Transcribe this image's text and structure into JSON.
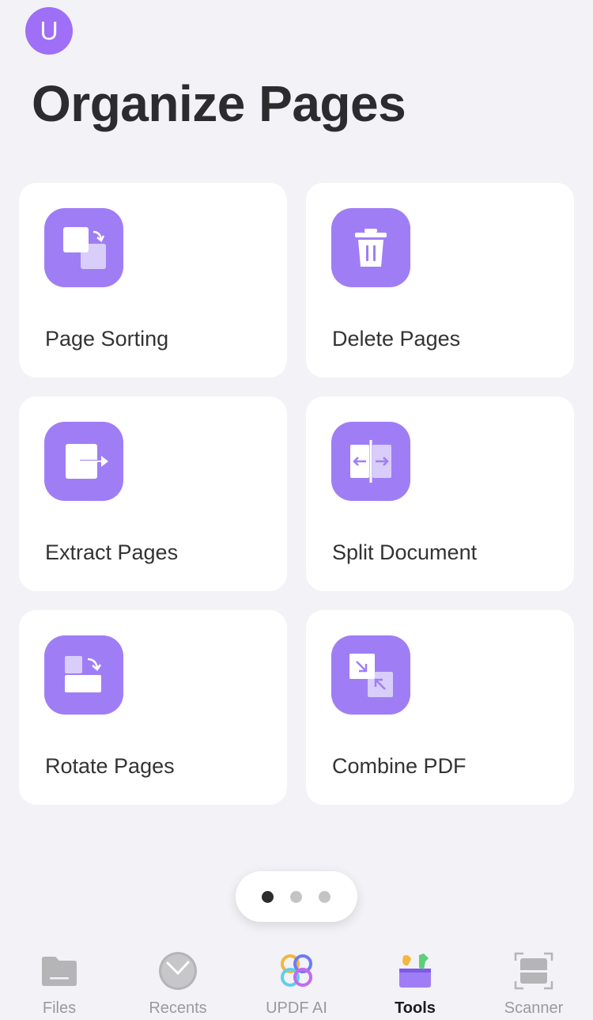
{
  "header": {
    "avatar_letter": "U",
    "title": "Organize Pages"
  },
  "tools": [
    {
      "label": "Page Sorting",
      "icon": "page-sorting-icon"
    },
    {
      "label": "Delete Pages",
      "icon": "trash-icon"
    },
    {
      "label": "Extract Pages",
      "icon": "extract-pages-icon"
    },
    {
      "label": "Split Document",
      "icon": "split-document-icon"
    },
    {
      "label": "Rotate Pages",
      "icon": "rotate-pages-icon"
    },
    {
      "label": "Combine PDF",
      "icon": "combine-pdf-icon"
    }
  ],
  "pager": {
    "pages": 3,
    "active": 1
  },
  "tabbar": {
    "items": [
      {
        "label": "Files",
        "icon": "folder-icon",
        "active": false
      },
      {
        "label": "Recents",
        "icon": "clock-icon",
        "active": false
      },
      {
        "label": "UPDF AI",
        "icon": "updf-ai-icon",
        "active": false
      },
      {
        "label": "Tools",
        "icon": "toolbox-icon",
        "active": true
      },
      {
        "label": "Scanner",
        "icon": "scanner-icon",
        "active": false
      }
    ]
  },
  "colors": {
    "accent": "#9f7ef5",
    "avatar": "#9f6ff7",
    "background": "#f2f2f7",
    "card": "#ffffff",
    "inactive_tab": "#9a9a9e"
  }
}
